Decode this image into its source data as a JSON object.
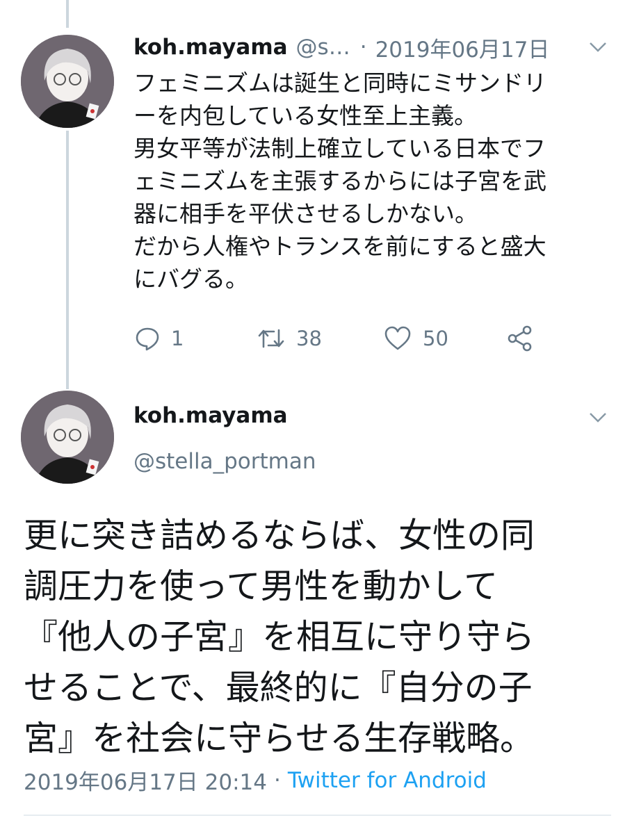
{
  "tweet1": {
    "name": "koh.mayama",
    "handle": "@s…",
    "separator": "·",
    "date": "2019年06月17日",
    "text_lines": [
      "フェミニズムは誕生と同時にミサンドリ",
      "ーを内包している女性至上主義。",
      "男女平等が法制上確立している日本でフ",
      "ェミニズムを主張するからには子宮を武",
      "器に相手を平伏させるしかない。",
      "だから人権やトランスを前にすると盛大",
      "にバグる。"
    ],
    "reply_count": "1",
    "retweet_count": "38",
    "like_count": "50"
  },
  "tweet2": {
    "name": "koh.mayama",
    "handle": "@stella_portman",
    "text_lines": [
      "更に突き詰めるならば、女性の同",
      "調圧力を使って男性を動かして",
      "『他人の子宮』を相互に守り守ら",
      "せることで、最終的に『自分の子",
      "宮』を社会に守らせる生存戦略。"
    ],
    "timestamp": "2019年06月17日 20:14",
    "separator": "·",
    "source": "Twitter for Android"
  },
  "icons": {
    "caret": "chevron-down-icon",
    "reply": "reply-icon",
    "retweet": "retweet-icon",
    "like": "heart-icon",
    "share": "share-icon"
  },
  "colors": {
    "text": "#14171a",
    "secondary": "#657786",
    "link": "#1da1f2",
    "thread_line": "#ccd6dd"
  }
}
